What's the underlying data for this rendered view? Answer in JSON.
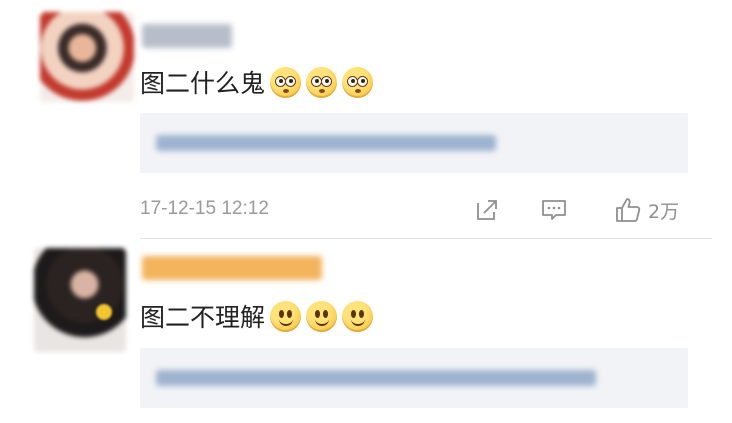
{
  "comments": [
    {
      "text": "图二什么鬼",
      "emoji": [
        "flushed-face",
        "flushed-face",
        "flushed-face"
      ],
      "timestamp": "17-12-15 12:12",
      "like_count": "2万"
    },
    {
      "text": "图二不理解",
      "emoji": [
        "slightly-smiling-face",
        "slightly-smiling-face",
        "slightly-smiling-face"
      ]
    }
  ],
  "icons": {
    "share": "share-icon",
    "reply": "comment-icon",
    "like": "thumbs-up-icon"
  },
  "colors": {
    "text": "#222222",
    "muted": "#9a9a9a",
    "reply_bg": "#f2f3f6",
    "divider": "#e6e6e6"
  }
}
